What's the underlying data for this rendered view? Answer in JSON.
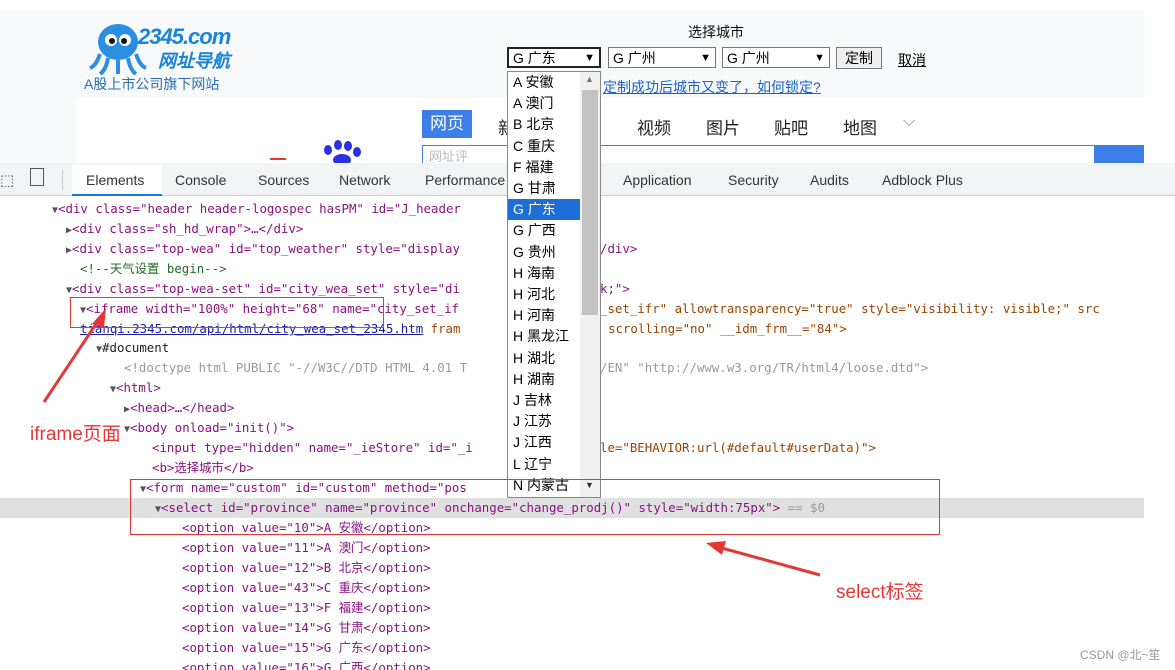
{
  "webpage": {
    "logo_text": "2345.com",
    "logo_sub": "网址导航",
    "tagline": "A股上市公司旗下网站",
    "city_title": "选择城市",
    "province_value": "G 广东",
    "city_value": "G 广州",
    "district_value": "G 广州",
    "set_button": "定制",
    "cancel_link": "取消",
    "notice": "定制成功后城市又变了，如何锁定?",
    "tabs": [
      "网页",
      "新",
      "视频",
      "图片",
      "贴吧",
      "地图"
    ],
    "search_placeholder": "网址评"
  },
  "dropdown_options": [
    "A 安徽",
    "A 澳门",
    "B 北京",
    "C 重庆",
    "F 福建",
    "G 甘肃",
    "G 广东",
    "G 广西",
    "G 贵州",
    "H 海南",
    "H 河北",
    "H 河南",
    "H 黑龙江",
    "H 湖北",
    "H 湖南",
    "J 吉林",
    "J 江苏",
    "J 江西",
    "L 辽宁",
    "N 内蒙古"
  ],
  "dropdown_selected": "G 广东",
  "devtools": {
    "tabs": [
      "Elements",
      "Console",
      "Sources",
      "Network",
      "Performance",
      "Application",
      "Security",
      "Audits",
      "Adblock Plus"
    ]
  },
  "dom": {
    "l1_open": "<div class=\"header header-logospec hasPM\" id=\"J_header",
    "l2": "<div class=\"sh_hd_wrap\">…</div>",
    "l3a": "<div class=\"top-wea\" id=\"top_weather\" style=\"display",
    "l3b": "/div>",
    "l4": "<!--天气设置 begin-->",
    "l5a": "<div class=\"top-wea-set\" id=\"city_wea_set\" style=\"di",
    "l5b": "k;\">",
    "l6a": "<iframe width=\"100%\" height=\"68\" name=\"city_set_if",
    "l6b": "_set_ifr\" allowtransparency=\"true\" style=\"visibility: visible;\" src",
    "l7a": "tianqi.2345.com/api/html/city_wea_set_2345.htm",
    "l7b": "fram",
    "l7c": "scrolling=\"no\" __idm_frm__=\"84\">",
    "l8": "#document",
    "l9a": "<!doctype html PUBLIC \"-//W3C//DTD HTML 4.01 T",
    "l9b": "/EN\" \"http://www.w3.org/TR/html4/loose.dtd\">",
    "l10": "<html>",
    "l11": "<head>…</head>",
    "l12": "<body onload=\"init()\">",
    "l13a": "<input type=\"hidden\" name=\"_ieStore\" id=\"_i",
    "l13b": "le=\"BEHAVIOR:url(#default#userData)\">",
    "l14": "<b>选择城市</b>",
    "l15": "<form name=\"custom\" id=\"custom\" method=\"pos",
    "l16": "<select id=\"province\" name=\"province\" onchange=\"change_prodj()\" style=\"width:75px\">",
    "l16_eq": " == $0",
    "options": [
      "<option value=\"10\">A 安徽</option>",
      "<option value=\"11\">A 澳门</option>",
      "<option value=\"12\">B 北京</option>",
      "<option value=\"43\">C 重庆</option>",
      "<option value=\"13\">F 福建</option>",
      "<option value=\"14\">G 甘肃</option>",
      "<option value=\"15\">G 广东</option>",
      "<option value=\"16\">G 广西</option>"
    ]
  },
  "annotations": {
    "iframe_label": "iframe页面",
    "select_label": "select标签"
  },
  "watermark": "CSDN @北~笙",
  "colors": {
    "accent": "#3d7ee8",
    "annotation": "#e63737",
    "selected": "#1e6ed8"
  }
}
